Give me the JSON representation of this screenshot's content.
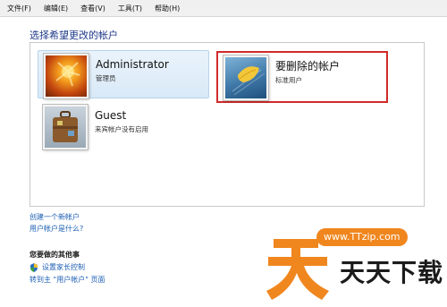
{
  "menu": [
    "文件(F)",
    "编辑(E)",
    "查看(V)",
    "工具(T)",
    "帮助(H)"
  ],
  "page_title": "选择希望更改的帐户",
  "accounts": [
    {
      "name": "Administrator",
      "role": "管理员"
    },
    {
      "name": "要删除的帐户",
      "role": "标准用户"
    },
    {
      "name": "Guest",
      "role": "来宾帐户没有启用"
    }
  ],
  "links": [
    "创建一个新帐户",
    "用户帐户是什么?"
  ],
  "other_tasks": {
    "heading": "您要做的其他事",
    "items": [
      "设置家长控制",
      "转到主 \"用户帐户\" 页面"
    ]
  },
  "watermark": {
    "url": "www.TTzip.com",
    "text": "天天下载"
  },
  "colors": {
    "link": "#1e5fb4",
    "highlight_border": "#d12a2a",
    "title": "#1e3a8a"
  }
}
